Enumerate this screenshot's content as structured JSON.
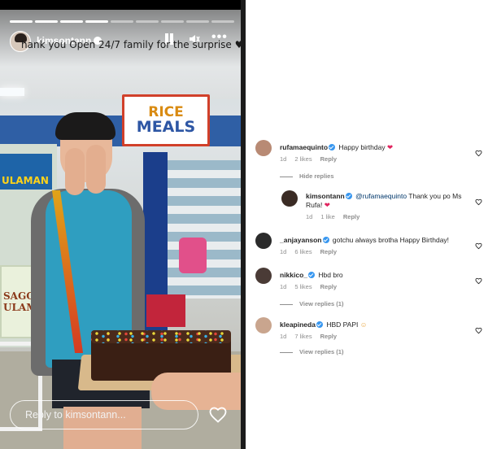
{
  "story": {
    "username": "kimsontann",
    "caption": "hank you Open 24/7 family for the surprise",
    "caption_emoji": "♥",
    "progress_total": 9,
    "progress_done": 4,
    "reply_placeholder": "Reply to kimsontann...",
    "scene_sign_line1": "RICE",
    "scene_sign_line2": "MEALS",
    "scene_banner": "ULAMAN",
    "scene_lower_sign_line1": "SAGO'T",
    "scene_lower_sign_line2": "ULAMAN"
  },
  "comments": [
    {
      "username": "rufamaequinto",
      "verified": true,
      "text": "Happy birthday",
      "emoji": "❤",
      "time": "1d",
      "likes": "2 likes",
      "reply_label": "Reply",
      "thread_toggle": "Hide replies",
      "avatar_color": "#b88a74"
    },
    {
      "username": "kimsontann",
      "verified": true,
      "mention": "@rufamaequinto",
      "text": "Thank you po Ms",
      "text_line2": "Rufa!",
      "emoji": "❤",
      "time": "1d",
      "likes": "1 like",
      "reply_label": "Reply",
      "avatar_color": "#3a2b24"
    },
    {
      "username": "_anjayanson",
      "verified": true,
      "text": "gotchu always brotha Happy Birthday!",
      "time": "1d",
      "likes": "6 likes",
      "reply_label": "Reply",
      "avatar_color": "#2b2b2b"
    },
    {
      "username": "nikkico_",
      "verified": true,
      "text": "Hbd bro",
      "time": "1d",
      "likes": "5 likes",
      "reply_label": "Reply",
      "thread_toggle": "View replies (1)",
      "avatar_color": "#4a3b36"
    },
    {
      "username": "kleapineda",
      "verified": true,
      "text": "HBD PAPI",
      "emoji": "☺",
      "time": "1d",
      "likes": "7 likes",
      "reply_label": "Reply",
      "thread_toggle": "View replies (1)",
      "avatar_color": "#c9a58e"
    }
  ],
  "colors": {
    "verified": "#3897f0",
    "meta_text": "#8e8e8e",
    "mention": "#00376b",
    "heart_red": "#e0245e"
  },
  "icons": {
    "story_like": "heart-outline-icon",
    "comment_like": "heart-outline-icon",
    "pause": "pause-icon",
    "mute": "speaker-muted-icon",
    "more": "more-horizontal-icon"
  }
}
